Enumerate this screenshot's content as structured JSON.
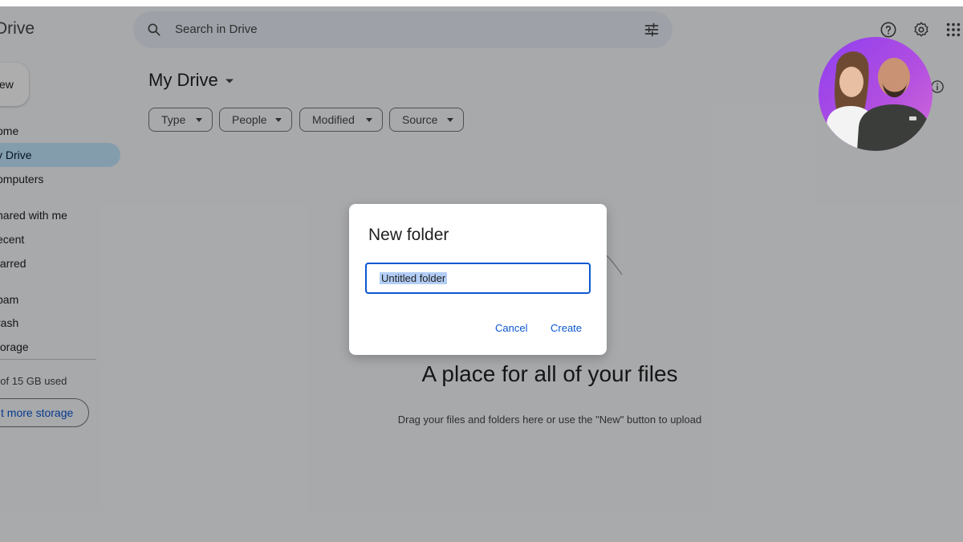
{
  "header": {
    "app_title": "Drive",
    "search_placeholder": "Search in Drive"
  },
  "sidebar": {
    "new_label": "ew",
    "items": [
      {
        "label": "ome"
      },
      {
        "label": "y Drive",
        "active": true
      },
      {
        "label": "omputers"
      },
      {
        "label": "hared with me"
      },
      {
        "label": "ecent"
      },
      {
        "label": "tarred"
      },
      {
        "label": "pam"
      },
      {
        "label": "rash"
      },
      {
        "label": "torage"
      }
    ],
    "storage_text": "B of 15 GB used",
    "get_storage_label": "t more storage"
  },
  "main": {
    "title": "My Drive",
    "filters": [
      {
        "label": "Type"
      },
      {
        "label": "People"
      },
      {
        "label": "Modified"
      },
      {
        "label": "Source"
      }
    ],
    "empty_title": "A place for all of your files",
    "empty_subtitle": "Drag your files and folders here or use the \"New\" button to upload"
  },
  "dialog": {
    "title": "New folder",
    "input_value": "Untitled folder",
    "cancel_label": "Cancel",
    "create_label": "Create"
  },
  "colors": {
    "accent": "#0b57d0",
    "active_nav": "#c2e7ff",
    "scrim": "rgba(0,0,0,0.32)"
  },
  "icons": [
    "search-icon",
    "tune-icon",
    "help-icon",
    "settings-icon",
    "apps-grid-icon",
    "info-icon",
    "caret-down-icon"
  ]
}
